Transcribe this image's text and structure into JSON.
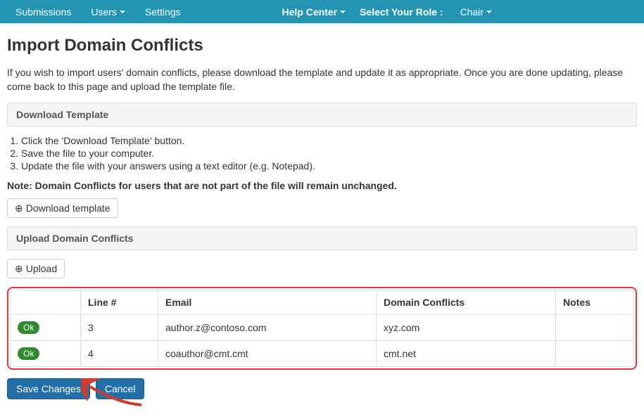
{
  "nav": {
    "submissions": "Submissions",
    "users": "Users",
    "settings": "Settings",
    "help": "Help Center",
    "select_role_label": "Select Your Role :",
    "role": "Chair"
  },
  "page": {
    "title": "Import Domain Conflicts",
    "intro": "If you wish to import users' domain conflicts, please download the template and update it as appropriate. Once you are done updating, please come back to this page and upload the template file."
  },
  "download": {
    "section_title": "Download Template",
    "steps": [
      "Click the 'Download Template' button.",
      "Save the file to your computer.",
      "Update the file with your answers using a text editor (e.g. Notepad)."
    ],
    "note": "Note: Domain Conflicts for users that are not part of the file will remain unchanged.",
    "button": "Download template"
  },
  "upload": {
    "section_title": "Upload Domain Conflicts",
    "button": "Upload"
  },
  "table": {
    "headers": {
      "status": "",
      "line": "Line #",
      "email": "Email",
      "domain": "Domain Conflicts",
      "notes": "Notes"
    },
    "rows": [
      {
        "status": "Ok",
        "line": "3",
        "email": "author.z@contoso.com",
        "domain": "xyz.com",
        "notes": ""
      },
      {
        "status": "Ok",
        "line": "4",
        "email": "coauthor@cmt.cmt",
        "domain": "cmt.net",
        "notes": ""
      }
    ]
  },
  "actions": {
    "save": "Save Changes",
    "cancel": "Cancel"
  }
}
